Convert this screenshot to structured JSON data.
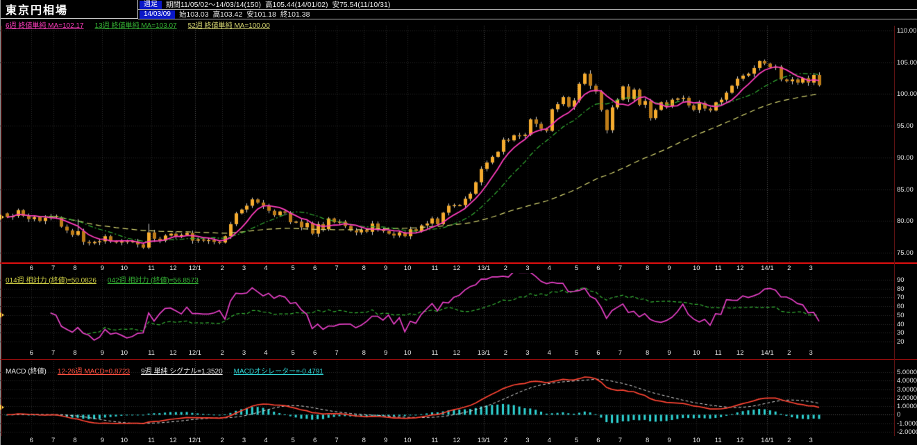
{
  "window": {
    "title": "東京円相場"
  },
  "header": {
    "timeframe": "週足",
    "period": "期間11/05/02〜14/03/14(150)",
    "high_all": "高105.44(14/01/02)",
    "low_all": "安75.54(11/10/31)",
    "date": "14/03/09",
    "open": "始103.03",
    "high": "高103.42",
    "low": "安101.18",
    "close": "終101.38"
  },
  "legends": {
    "price": [
      {
        "label": "6週 終値単純 MA=102.17",
        "color": "#ff3dbd",
        "underline": true
      },
      {
        "label": "13週 終値単純 MA=103.07",
        "color": "#35b335",
        "underline": true
      },
      {
        "label": "52週 終値単純 MA=100.00",
        "color": "#d9d973",
        "underline": true
      }
    ],
    "rsi": [
      {
        "label": "014週 相対力 (終値)=50.0826",
        "color": "#cfcf45",
        "underline": true
      },
      {
        "label": "042週 相対力 (終値)=56.8573",
        "color": "#35b335",
        "underline": true
      }
    ],
    "macd": [
      {
        "label": "MACD (終値)",
        "color": "#e8e8e8",
        "underline": false
      },
      {
        "label": "12-26週 MACD=0.8723",
        "color": "#ff5040",
        "underline": true
      },
      {
        "label": "9週 単純 シグナル=1.3520",
        "color": "#e8e8e8",
        "underline": true
      },
      {
        "label": "MACDオシレーター=-0.4791",
        "color": "#2fd3d3",
        "underline": true
      }
    ]
  },
  "colors": {
    "bg": "#000000",
    "candle_up": "#f6ac2f",
    "candle_down": "#bd7c18",
    "wick": "#cfcfcf",
    "ma6": "#ff3dbd",
    "ma13": "#35b335",
    "ma52": "#d9d973",
    "rsi14": "#e840c8",
    "rsi42": "#35b335",
    "macd_line": "#ff4433",
    "signal_line": "#dddddd",
    "osc_bar": "#2fd3d3",
    "grid": "#2e2e2e",
    "grid_bright": "#565656",
    "separator": "#e01010",
    "badge_bg": "#0a18c8",
    "marker": "#ffd24a"
  },
  "chart_data": {
    "type": "candlestick",
    "title": "東京円相場",
    "period": {
      "label": "11/05/02〜14/03/14",
      "start_iso": "2011-05-02",
      "bars": 150,
      "timeframe": "weekly"
    },
    "axes": {
      "price_ticks": [
        "110.00",
        "105.00",
        "100.00",
        "95.00",
        "90.00",
        "85.00",
        "80.00",
        "75.00"
      ],
      "rsi_ticks": [
        "90",
        "80",
        "70",
        "60",
        "50",
        "40",
        "30",
        "20"
      ],
      "macd_ticks": [
        "5.0000",
        "4.0000",
        "3.0000",
        "2.0000",
        "1.0000",
        "0",
        "-1.0000",
        "-2.0000"
      ],
      "x_ticks": [
        "6",
        "7",
        "8",
        "9",
        "10",
        "11",
        "12",
        "12/1",
        "2",
        "3",
        "4",
        "5",
        "6",
        "7",
        "8",
        "9",
        "10",
        "11",
        "12",
        "13/1",
        "2",
        "3",
        "4",
        "5",
        "6",
        "7",
        "8",
        "9",
        "10",
        "11",
        "12",
        "14/1",
        "2",
        "3"
      ]
    },
    "price_panel": {
      "ylim": [
        75,
        110
      ],
      "first_open": 81.2,
      "closes": [
        80.6,
        80.8,
        81.7,
        80.8,
        80.3,
        80.6,
        80.0,
        80.5,
        80.8,
        80.6,
        79.1,
        78.5,
        77.8,
        78.4,
        76.7,
        76.5,
        76.7,
        76.8,
        77.6,
        76.8,
        76.6,
        76.8,
        76.7,
        76.8,
        76.3,
        75.8,
        78.2,
        77.2,
        76.9,
        77.7,
        78.0,
        77.6,
        77.8,
        78.1,
        76.9,
        77.1,
        76.9,
        77.0,
        76.7,
        76.6,
        77.6,
        79.5,
        81.2,
        81.8,
        82.4,
        83.4,
        82.9,
        82.4,
        81.6,
        80.9,
        81.5,
        81.3,
        79.8,
        79.9,
        79.0,
        79.7,
        78.0,
        79.5,
        78.7,
        80.4,
        79.8,
        79.9,
        79.2,
        78.5,
        78.2,
        78.6,
        78.3,
        79.6,
        78.7,
        78.4,
        78.0,
        77.7,
        78.2,
        77.6,
        78.7,
        78.4,
        79.3,
        79.6,
        80.4,
        79.5,
        81.3,
        82.4,
        82.5,
        82.5,
        83.5,
        84.3,
        86.1,
        88.2,
        89.2,
        90.1,
        90.9,
        92.8,
        92.7,
        93.5,
        93.4,
        93.6,
        96.0,
        95.3,
        94.5,
        94.2,
        97.6,
        98.4,
        99.5,
        98.0,
        99.0,
        101.6,
        103.2,
        101.3,
        100.4,
        97.5,
        94.3,
        97.9,
        99.1,
        101.2,
        99.2,
        100.7,
        98.3,
        98.9,
        96.2,
        97.5,
        98.7,
        98.1,
        99.1,
        99.3,
        99.4,
        98.2,
        97.5,
        98.6,
        97.7,
        97.4,
        98.7,
        99.1,
        100.2,
        101.3,
        102.4,
        102.9,
        103.2,
        104.1,
        105.2,
        104.8,
        104.2,
        104.3,
        102.3,
        102.0,
        102.3,
        101.8,
        102.5,
        101.8,
        103.0,
        101.38
      ],
      "wick_overrides": {
        "13": {
          "h": 80.3
        },
        "25": {
          "l": 75.6
        },
        "26": {
          "l": 75.54,
          "h": 79.55
        },
        "107": {
          "h": 103.74
        },
        "110": {
          "l": 93.79
        },
        "138": {
          "h": 105.3
        },
        "139": {
          "h": 105.44
        },
        "149": {
          "h": 103.42,
          "l": 101.18
        }
      },
      "ma_periods": [
        6,
        13,
        52
      ],
      "ma_current": [
        102.17,
        103.07,
        100.0
      ]
    },
    "rsi_panel": {
      "ylim": [
        20,
        90
      ],
      "periods": [
        14,
        42
      ],
      "current": [
        50.0826,
        56.8573
      ]
    },
    "macd_panel": {
      "ylim": [
        -2,
        5
      ],
      "fast": 12,
      "slow": 26,
      "signal_period": 9,
      "current_macd": 0.8723,
      "current_signal": 1.352,
      "current_osc": -0.4791
    }
  }
}
